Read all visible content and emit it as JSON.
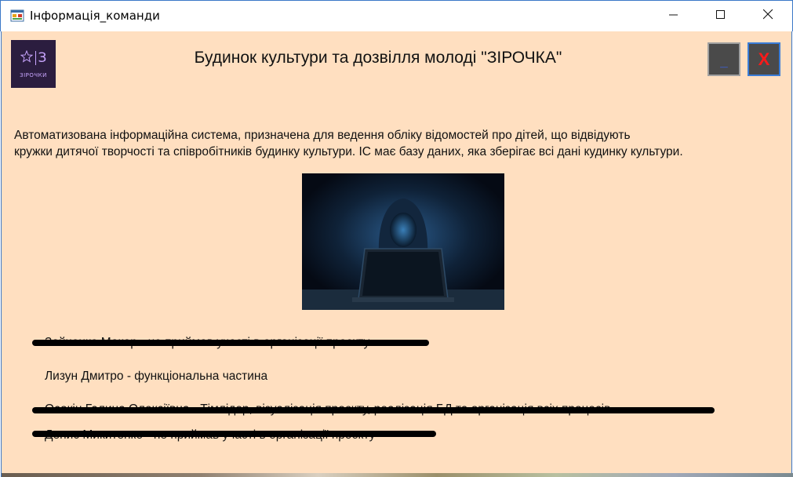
{
  "window": {
    "title": "Інформація_команди",
    "icons": {
      "app": "windows-form-icon",
      "minimize": "minimize-icon",
      "maximize": "maximize-icon",
      "close": "close-icon"
    }
  },
  "header": {
    "logo": {
      "letter": "З",
      "caption": "ЗІРОЧКИ",
      "icon": "star-icon"
    },
    "title": "Будинок культури та дозвілля молоді \"ЗІРОЧКА\"",
    "minimize_label": "_",
    "close_label": "X"
  },
  "description": {
    "line1": "Автоматизована інформаційна система, призначена  для ведення обліку відомостей  про дітей, що відвідують",
    "line2": "кружки дитячої творчості та співробітників будинку культури. ІС має базу даних, яка зберігає всі дані кудинку культури."
  },
  "image": {
    "subject": "hooded-hacker-with-laptop"
  },
  "team": [
    {
      "text": "Зайченко Макар - не приймав участі в організації проєкту",
      "struck": true
    },
    {
      "text": "Лизун Дмитро - функціональна частина",
      "struck": false
    },
    {
      "text": "Осокін Галина Олексіївна - Тімлідер, візуалізація проєкту, реалізація БД та організація всіх процесів",
      "struck": true
    },
    {
      "text": "Денис Микитенко - не приймав участі в організації проєкту",
      "struck": true
    }
  ],
  "colors": {
    "background": "#ffdfc0",
    "close_accent": "#ff1a1a",
    "minimize_accent": "#3a66ff"
  }
}
